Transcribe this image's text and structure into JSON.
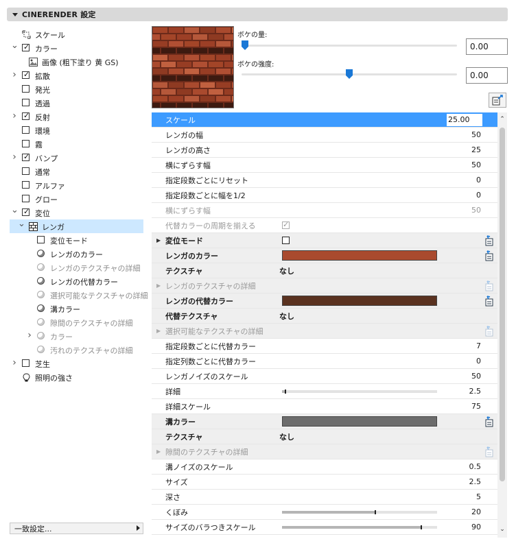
{
  "panel": {
    "title": "CINERENDER 設定"
  },
  "tree": {
    "items": [
      {
        "label": "スケール",
        "kind": "scale-icon",
        "level": 1,
        "arrow": ""
      },
      {
        "label": "カラー",
        "kind": "checkbox-checked",
        "level": 1,
        "arrow": "expanded"
      },
      {
        "label": "画像 (粗下塗り 黄 GS)",
        "kind": "image-icon",
        "level": 2,
        "arrow": ""
      },
      {
        "label": "拡散",
        "kind": "checkbox-checked",
        "level": 1,
        "arrow": "collapsed"
      },
      {
        "label": "発光",
        "kind": "checkbox",
        "level": 1,
        "arrow": ""
      },
      {
        "label": "透過",
        "kind": "checkbox",
        "level": 1,
        "arrow": ""
      },
      {
        "label": "反射",
        "kind": "checkbox-checked",
        "level": 1,
        "arrow": "collapsed"
      },
      {
        "label": "環境",
        "kind": "checkbox",
        "level": 1,
        "arrow": ""
      },
      {
        "label": "霧",
        "kind": "checkbox",
        "level": 1,
        "arrow": ""
      },
      {
        "label": "バンプ",
        "kind": "checkbox-checked",
        "level": 1,
        "arrow": "collapsed"
      },
      {
        "label": "通常",
        "kind": "checkbox",
        "level": 1,
        "arrow": ""
      },
      {
        "label": "アルファ",
        "kind": "checkbox",
        "level": 1,
        "arrow": ""
      },
      {
        "label": "グロー",
        "kind": "checkbox",
        "level": 1,
        "arrow": ""
      },
      {
        "label": "変位",
        "kind": "checkbox-checked",
        "level": 1,
        "arrow": "expanded"
      },
      {
        "label": "レンガ",
        "kind": "brick-icon",
        "level": 2,
        "arrow": "expanded",
        "selected": true
      },
      {
        "label": "変位モード",
        "kind": "checkbox",
        "level": 3,
        "arrow": ""
      },
      {
        "label": "レンガのカラー",
        "kind": "radio",
        "level": 3,
        "arrow": ""
      },
      {
        "label": "レンガのテクスチャの詳細",
        "kind": "radio-dim",
        "level": 3,
        "arrow": "",
        "dim": true
      },
      {
        "label": "レンガの代替カラー",
        "kind": "radio",
        "level": 3,
        "arrow": ""
      },
      {
        "label": "選択可能なテクスチャの詳細",
        "kind": "radio-dim",
        "level": 3,
        "arrow": "",
        "dim": true
      },
      {
        "label": "溝カラー",
        "kind": "radio",
        "level": 3,
        "arrow": ""
      },
      {
        "label": "隙間のテクスチャの詳細",
        "kind": "radio-dim",
        "level": 3,
        "arrow": "",
        "dim": true
      },
      {
        "label": "カラー",
        "kind": "radio-dim",
        "level": 3,
        "arrow": "collapsed",
        "dim": true
      },
      {
        "label": "汚れのテクスチャの詳細",
        "kind": "radio-dim",
        "level": 3,
        "arrow": "",
        "dim": true
      },
      {
        "label": "芝生",
        "kind": "checkbox",
        "level": 1,
        "arrow": "collapsed"
      },
      {
        "label": "照明の強さ",
        "kind": "light-icon",
        "level": 1,
        "arrow": ""
      }
    ],
    "footer_button": "一致設定..."
  },
  "preview": {
    "bokeh_amount_label": "ボケの量:",
    "bokeh_amount_value": "0.00",
    "bokeh_amount_level": 0.0,
    "bokeh_strength_label": "ボケの強度:",
    "bokeh_strength_value": "0.00",
    "bokeh_strength_level": 0.5
  },
  "colors": {
    "brick": "#a94a2e",
    "brick_alt": "#5a3220",
    "groove": "#6c6c6c",
    "selection": "#3d9bff",
    "tree_selection": "#cde8ff"
  },
  "properties": [
    {
      "type": "value",
      "name": "スケール",
      "value": "25.00",
      "selected": true
    },
    {
      "type": "value",
      "name": "レンガの幅",
      "value": "50"
    },
    {
      "type": "value",
      "name": "レンガの高さ",
      "value": "25"
    },
    {
      "type": "value",
      "name": "横にずらす幅",
      "value": "50"
    },
    {
      "type": "value",
      "name": "指定段数ごとにリセット",
      "value": "0"
    },
    {
      "type": "value",
      "name": "指定段数ごとに幅を1/2",
      "value": "0"
    },
    {
      "type": "value",
      "name": "横にずらす幅",
      "value": "50",
      "dim": true
    },
    {
      "type": "check",
      "name": "代替カラーの周期を揃える",
      "checked": true,
      "dim": true
    },
    {
      "type": "group-check",
      "name": "変位モード",
      "checked": false,
      "arrow": true
    },
    {
      "type": "group-color",
      "name": "レンガのカラー",
      "color": "brick"
    },
    {
      "type": "group-text",
      "name": "テクスチャ",
      "text": "なし"
    },
    {
      "type": "group-dim",
      "name": "レンガのテクスチャの詳細",
      "arrow": true
    },
    {
      "type": "group-color",
      "name": "レンガの代替カラー",
      "color": "brick_alt"
    },
    {
      "type": "group-text",
      "name": "代替テクスチャ",
      "text": "なし"
    },
    {
      "type": "group-dim",
      "name": "選択可能なテクスチャの詳細",
      "arrow": true
    },
    {
      "type": "value",
      "name": "指定段数ごとに代替カラー",
      "value": "7"
    },
    {
      "type": "value",
      "name": "指定列数ごとに代替カラー",
      "value": "0"
    },
    {
      "type": "value",
      "name": "レンガノイズのスケール",
      "value": "50"
    },
    {
      "type": "slider",
      "name": "詳細",
      "value": "2.5",
      "level": 0.02
    },
    {
      "type": "value",
      "name": "詳細スケール",
      "value": "75"
    },
    {
      "type": "group-color",
      "name": "溝カラー",
      "color": "groove"
    },
    {
      "type": "group-text",
      "name": "テクスチャ",
      "text": "なし"
    },
    {
      "type": "group-dim",
      "name": "隙間のテクスチャの詳細",
      "arrow": true
    },
    {
      "type": "value",
      "name": "溝ノイズのスケール",
      "value": "0.5"
    },
    {
      "type": "value",
      "name": "サイズ",
      "value": "2.5"
    },
    {
      "type": "value",
      "name": "深さ",
      "value": "5"
    },
    {
      "type": "slider",
      "name": "くぼみ",
      "value": "20",
      "level": 0.6
    },
    {
      "type": "slider",
      "name": "サイズのバラつきスケール",
      "value": "90",
      "level": 0.9
    }
  ]
}
